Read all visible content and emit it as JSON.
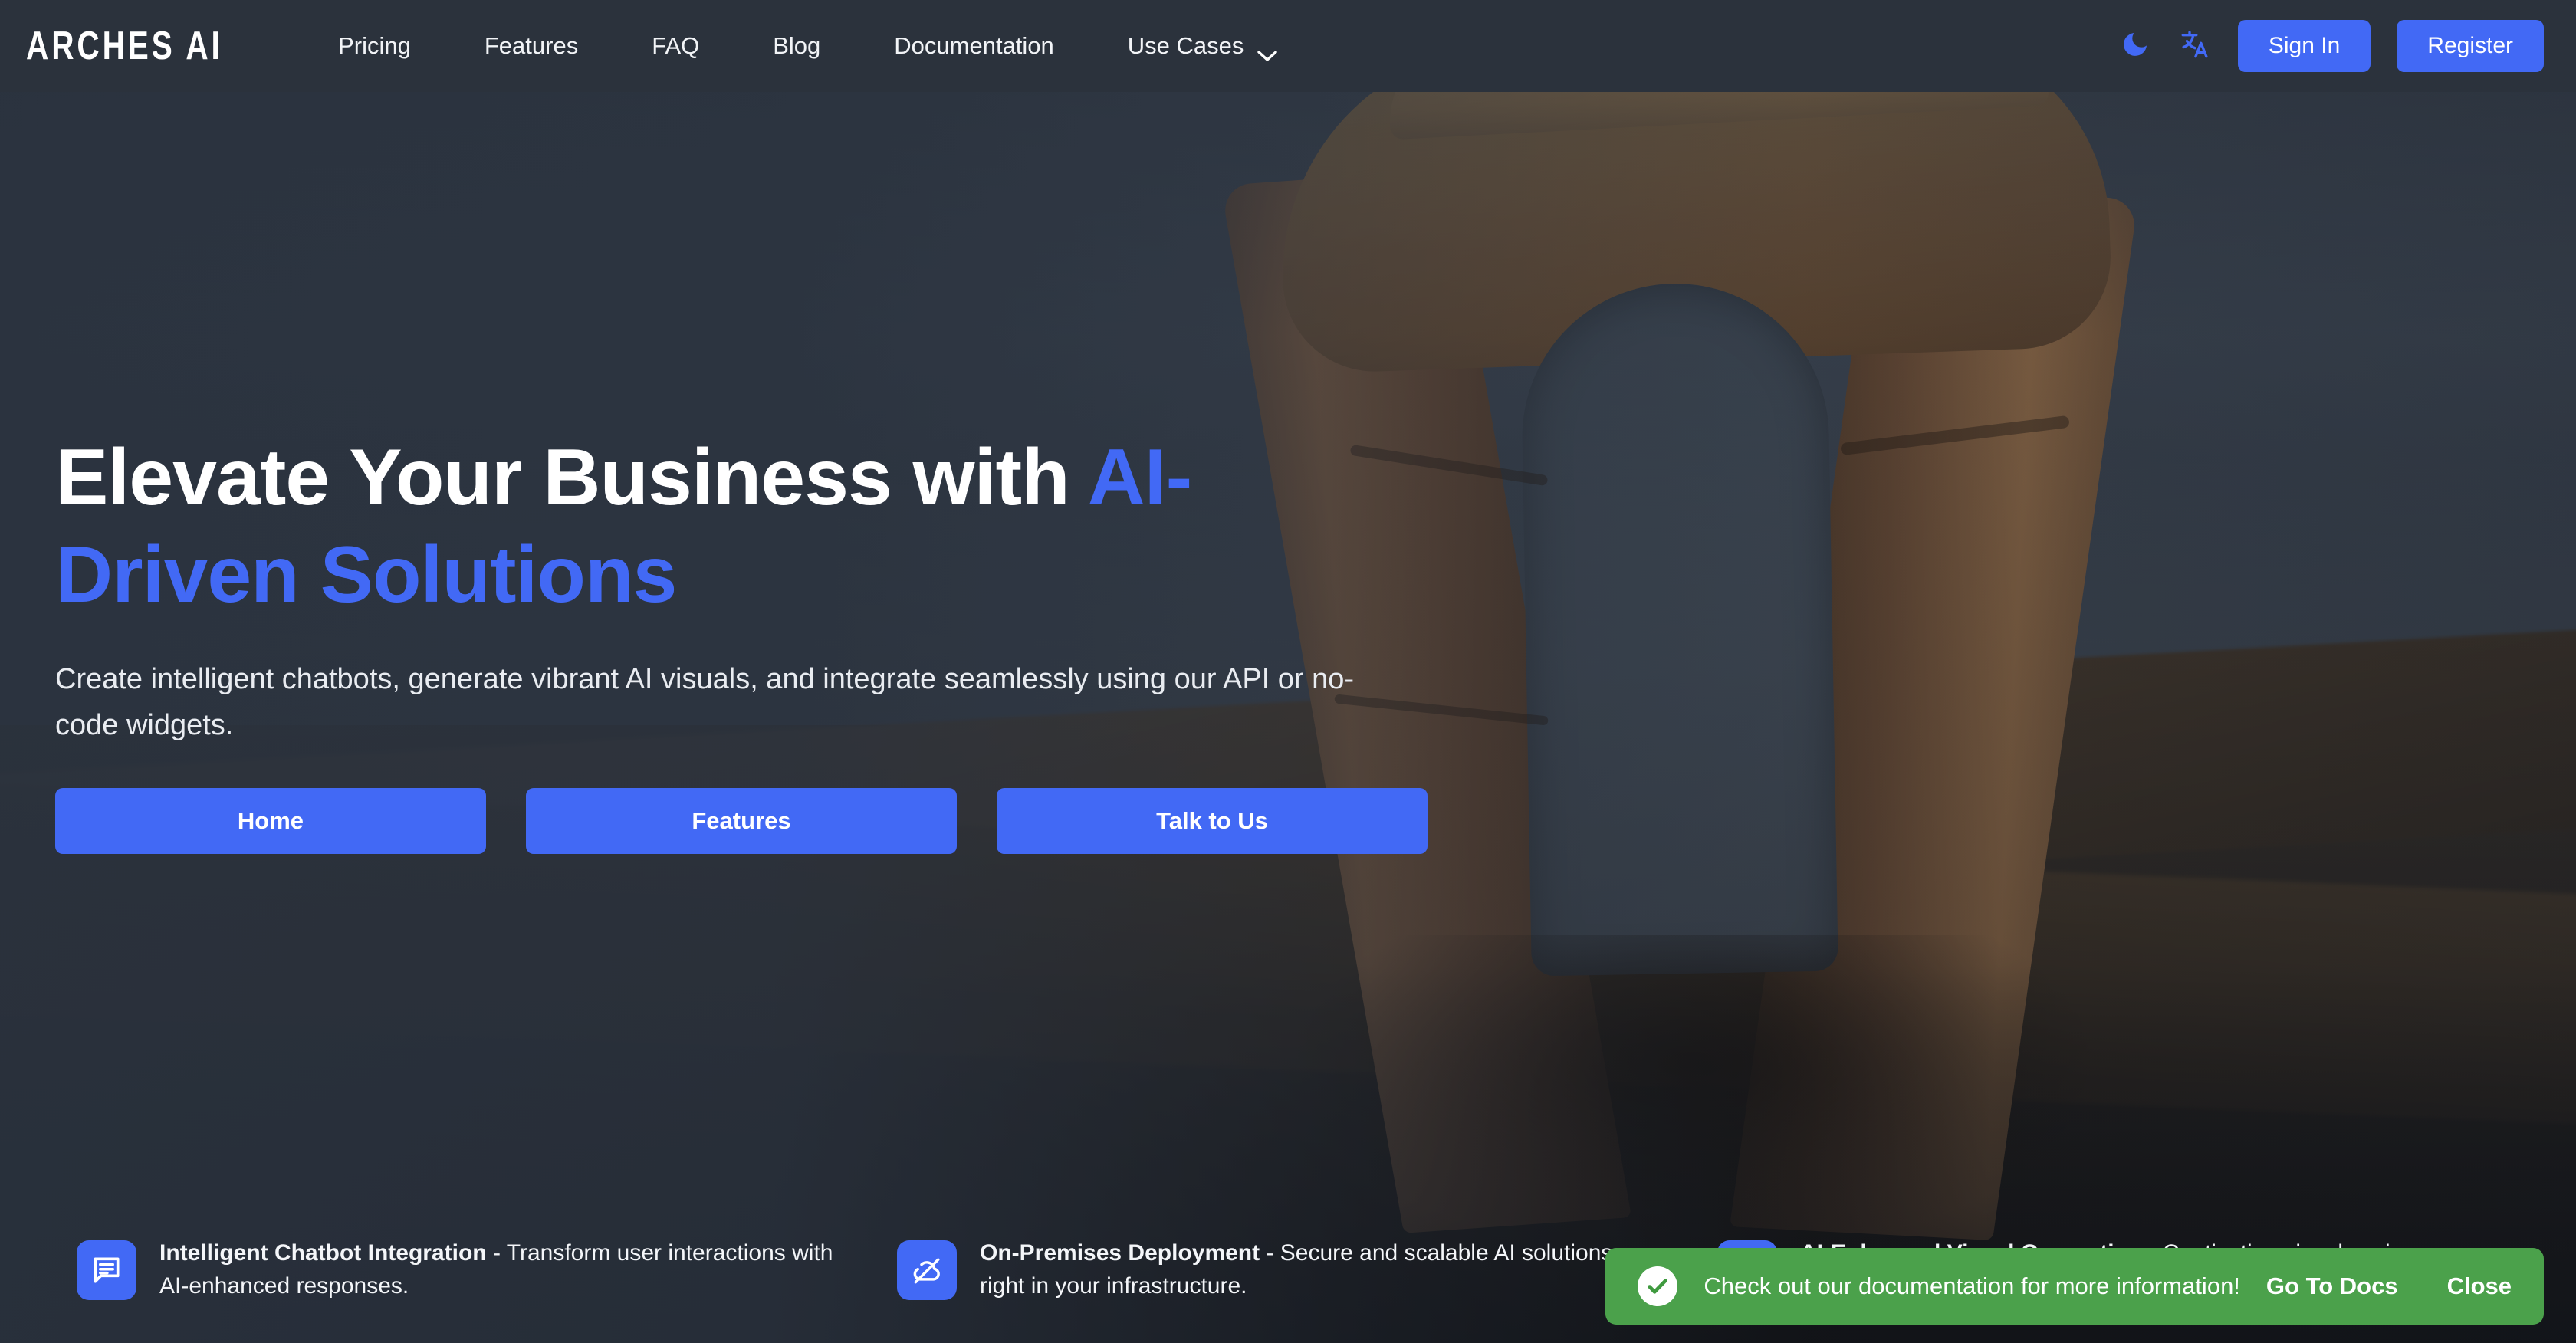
{
  "brand": {
    "logo_text": "ARCHES AI"
  },
  "nav": {
    "links": [
      {
        "label": "Pricing",
        "name": "nav-link-pricing"
      },
      {
        "label": "Features",
        "name": "nav-link-features"
      },
      {
        "label": "FAQ",
        "name": "nav-link-faq"
      },
      {
        "label": "Blog",
        "name": "nav-link-blog"
      },
      {
        "label": "Documentation",
        "name": "nav-link-documentation"
      },
      {
        "label": "Use Cases",
        "name": "nav-link-use-cases",
        "has_caret": true
      }
    ],
    "dark_mode_icon": "moon-icon",
    "language_icon": "translate-icon",
    "sign_in_label": "Sign In",
    "register_label": "Register"
  },
  "hero": {
    "title_plain": "Elevate Your Business with ",
    "title_accent": "AI-Driven Solutions",
    "subtitle": "Create intelligent chatbots, generate vibrant AI visuals, and integrate seamlessly using our API or no-code widgets.",
    "buttons": [
      {
        "label": "Home",
        "name": "hero-button-home"
      },
      {
        "label": "Features",
        "name": "hero-button-features"
      },
      {
        "label": "Talk to Us",
        "name": "hero-button-talk-to-us"
      }
    ],
    "background_image": "delicate-arch-photo"
  },
  "features": [
    {
      "icon": "chat-bubble-icon",
      "title": "Intelligent Chatbot Integration",
      "separator": " - ",
      "description": "Transform user interactions with AI-enhanced responses."
    },
    {
      "icon": "cloud-off-icon",
      "title": "On-Premises Deployment",
      "separator": " - ",
      "description": "Secure and scalable AI solutions right in your infrastructure."
    },
    {
      "icon": "image-sparkle-icon",
      "title": "AI-Enhanced Visual Generation",
      "separator": " - ",
      "description": "Captivating visuals using advanced"
    }
  ],
  "toast": {
    "icon": "check-circle-icon",
    "message": "Check out our documentation for more information!",
    "primary_action": "Go To Docs",
    "secondary_action": "Close"
  },
  "colors": {
    "navbar_bg": "#2b323c",
    "accent_blue": "#4269f5",
    "toast_green": "#4ba14b",
    "text_light": "#ffffff",
    "hero_overlay": "#2a323e"
  }
}
